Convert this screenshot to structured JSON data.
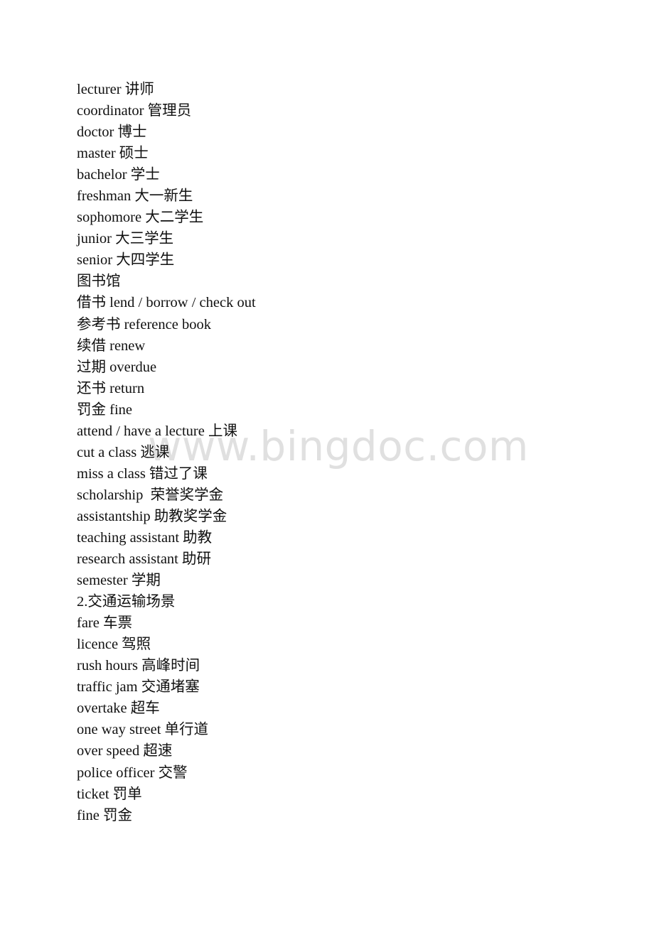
{
  "document": {
    "background_color": "#ffffff",
    "text_color": "#101010",
    "watermark": {
      "text": "www.bingdoc.com",
      "color": "#e0e0e0"
    },
    "lines": [
      {
        "text": "lecturer 讲师"
      },
      {
        "text": "coordinator 管理员"
      },
      {
        "text": "doctor 博士"
      },
      {
        "text": "master 硕士"
      },
      {
        "text": "bachelor 学士"
      },
      {
        "text": "freshman 大一新生"
      },
      {
        "text": "sophomore 大二学生"
      },
      {
        "text": "junior 大三学生"
      },
      {
        "text": "senior 大四学生"
      },
      {
        "text": "图书馆"
      },
      {
        "text": "借书 lend / borrow / check out"
      },
      {
        "text": "参考书 reference book"
      },
      {
        "text": "续借 renew"
      },
      {
        "text": "过期 overdue"
      },
      {
        "text": "还书 return"
      },
      {
        "text": "罚金 fine"
      },
      {
        "text": "attend / have a lecture 上课"
      },
      {
        "text": "cut a class 逃课"
      },
      {
        "text": "miss a class 错过了课"
      },
      {
        "text": "scholarship  荣誉奖学金"
      },
      {
        "text": "assistantship 助教奖学金"
      },
      {
        "text": "teaching assistant 助教"
      },
      {
        "text": "research assistant 助研"
      },
      {
        "text": "semester 学期"
      },
      {
        "text": "2.交通运输场景"
      },
      {
        "text": "fare 车票"
      },
      {
        "text": "licence 驾照"
      },
      {
        "text": "rush hours 高峰时间"
      },
      {
        "text": "traffic jam 交通堵塞"
      },
      {
        "text": "overtake 超车"
      },
      {
        "text": "one way street 单行道"
      },
      {
        "text": "over speed 超速"
      },
      {
        "text": "police officer 交警"
      },
      {
        "text": "ticket 罚单"
      },
      {
        "text": "fine 罚金"
      }
    ]
  }
}
